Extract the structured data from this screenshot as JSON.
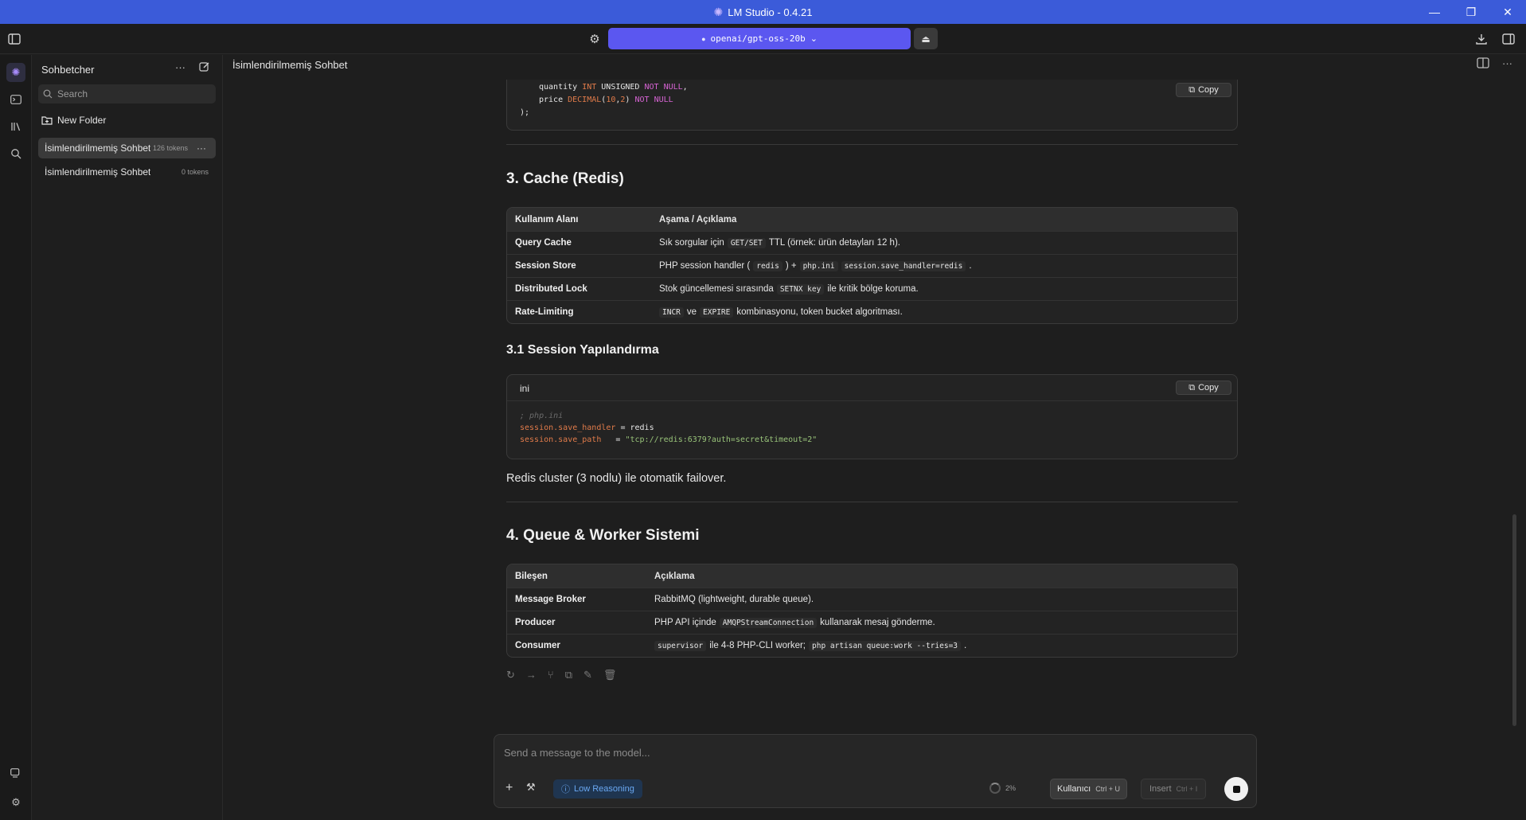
{
  "window": {
    "title": "LM Studio - 0.4.21",
    "minimize": "—",
    "maximize": "❐",
    "close": "✕"
  },
  "toolbar": {
    "model_name": "openai/gpt-oss-20b",
    "model_chevron": "⌄"
  },
  "sidebar": {
    "title": "Sohbetcher",
    "search_placeholder": "Search",
    "new_folder_label": "New Folder",
    "chats": [
      {
        "name": "İsimlendirilmemiş Sohbet",
        "tokens": "126 tokens"
      },
      {
        "name": "İsimlendirilmemiş Sohbet",
        "tokens": "0 tokens"
      }
    ]
  },
  "chat": {
    "title": "İsimlendirilmemiş Sohbet"
  },
  "content": {
    "sql_lines": {
      "quantity_name": "quantity ",
      "quantity_type": "INT",
      "quantity_unsigned": "UNSIGNED",
      "quantity_notnull": "NOT NULL",
      "quantity_tail": ",",
      "price_name": "price ",
      "price_type": "DECIMAL",
      "price_open": "(",
      "price_n1": "10",
      "price_comma": ",",
      "price_n2": "2",
      "price_close": ")",
      "price_notnull": "NOT NULL",
      "close": ");"
    },
    "copy_label": "Copy",
    "section3_title": "3. Cache (Redis)",
    "cache_table": {
      "headers": [
        "Kullanım Alanı",
        "Aşama / Açıklama"
      ],
      "rows": [
        {
          "area": "Query Cache",
          "p1": "Sık sorgular için",
          "c1": "GET/SET",
          "p2": "TTL (örnek: ürün detayları 12 h)."
        },
        {
          "area": "Session Store",
          "p1": "PHP session handler (",
          "c1": "redis",
          "p2": ") +",
          "c2": "php.ini",
          "c3": "session.save_handler=redis",
          "p3": "."
        },
        {
          "area": "Distributed Lock",
          "p1": "Stok güncellemesi sırasında",
          "c1": "SETNX key",
          "p2": "ile kritik bölge koruma."
        },
        {
          "area": "Rate-Limiting",
          "c1": "INCR",
          "p1": "ve",
          "c2": "EXPIRE",
          "p2": "kombinasyonu, token bucket algoritması."
        }
      ]
    },
    "section31_title": "3.1 Session Yapılandırma",
    "ini_block": {
      "lang": "ini",
      "comment": "; php.ini",
      "key1": "session.save_handler",
      "eq1": " = ",
      "val1": "redis",
      "key2": "session.save_path",
      "eq2": "   = ",
      "val2": "\"tcp://redis:6379?auth=secret&timeout=2\""
    },
    "redis_note": "Redis cluster (3 nodlu) ile otomatik failover.",
    "section4_title": "4. Queue & Worker Sistemi",
    "queue_table": {
      "headers": [
        "Bileşen",
        "Açıklama"
      ],
      "rows": [
        {
          "comp": "Message Broker",
          "p1": "RabbitMQ (lightweight, durable queue)."
        },
        {
          "comp": "Producer",
          "p1": "PHP API içinde",
          "c1": "AMQPStreamConnection",
          "p2": "kullanarak mesaj gönderme."
        },
        {
          "comp": "Consumer",
          "c1": "supervisor",
          "p1": "ile 4-8 PHP-CLI worker;",
          "c2": "php artisan queue:work --tries=3",
          "p2": "."
        }
      ]
    }
  },
  "composer": {
    "placeholder": "Send a message to the model...",
    "reasoning_label": "Low Reasoning",
    "context_pct": "2%",
    "role_label": "Kullanıcı",
    "role_shortcut": "Ctrl + U",
    "insert_label": "Insert",
    "insert_shortcut": "Ctrl + I"
  },
  "colors": {
    "titlebar": "#3b5bd9",
    "model_pill": "#5b57f0",
    "accent_purple": "#a78bfa",
    "reasoning_blue": "#6aa8f2"
  }
}
